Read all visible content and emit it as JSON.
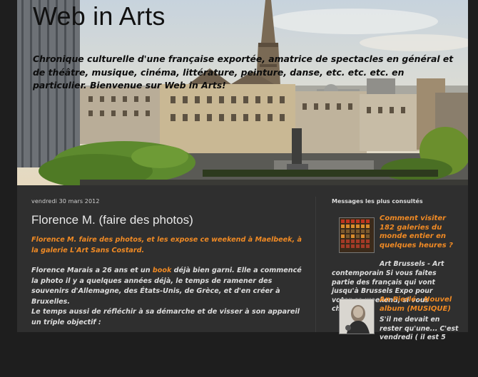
{
  "blog": {
    "title": "Web in Arts",
    "description": "Chronique culturelle d'une française exportée, amatrice de spectacles en général et de théâtre, musique, cinéma, littérature, peinture, danse, etc. etc. etc. en particulier. Bienvenue sur Web in Arts!"
  },
  "post": {
    "date": "vendredi 30 mars 2012",
    "title": "Florence M. (faire des photos)",
    "lead": "Florence M. faire des photos, et les expose ce weekend à Maelbeek, à la galerie L'Art Sans Costard.",
    "para1_before": "Florence Marais a 26 ans et un ",
    "para1_link": "book",
    "para1_after": " déjà bien garni. Elle a commencé la photo il y a quelques années déjà, le temps de ramener des souvenirs d'Allemagne, des États-Unis, de Grèce, et d'en créer à Bruxelles.",
    "para2": "Le temps aussi de réfléchir à sa démarche et de visser à son appareil un triple objectif :"
  },
  "sidebar": {
    "widget_title": "Messages les plus consultés",
    "items": [
      {
        "title": "Comment visiter 182 galeries du monde entier en quelques heures ?",
        "snippet_line1": "Art Brussels - Art",
        "snippet_rest": "contemporain Si vous faites partie des français qui vont jusqu'à Brussels Expo pour voter ce weekend, si vous cherc...",
        "thumb_icon": "gallery-poster-thumbnail"
      },
      {
        "title": "An Pierlé - Nouvel album (MUSIQUE)",
        "snippet": "S'il ne devait en rester qu'une... C'est vendredi ( il est 5",
        "thumb_icon": "singer-photo-thumbnail"
      }
    ]
  },
  "colors": {
    "accent": "#f08a24",
    "panel": "#2f2f2f",
    "background": "#1e1e1e",
    "text": "#dedede"
  }
}
